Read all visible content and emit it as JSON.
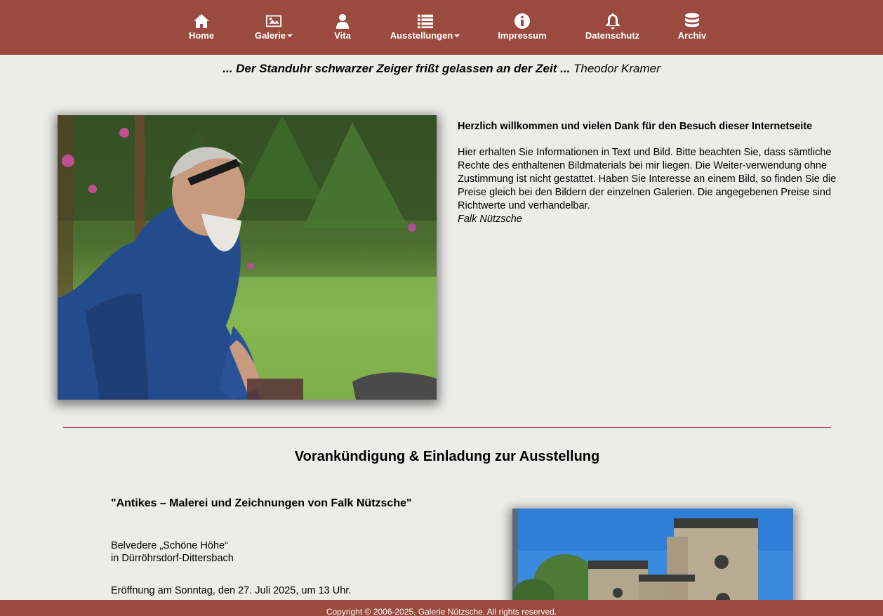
{
  "nav": {
    "items": [
      {
        "label": "Home",
        "icon": "home-icon"
      },
      {
        "label": "Galerie",
        "icon": "picture-icon",
        "dropdown": true
      },
      {
        "label": "Vita",
        "icon": "user-icon"
      },
      {
        "label": "Ausstellungen",
        "icon": "list-icon",
        "dropdown": true
      },
      {
        "label": "Impressum",
        "icon": "info-icon"
      },
      {
        "label": "Datenschutz",
        "icon": "bell-icon"
      },
      {
        "label": "Archiv",
        "icon": "database-icon"
      }
    ]
  },
  "motto": {
    "quote": "... Der Standuhr schwarzer Zeiger frißt gelassen an der Zeit ...",
    "author": "Theodor Kramer"
  },
  "welcome": {
    "heading": "Herzlich willkommen und vielen Dank für den Besuch dieser Internetseite",
    "body": "Hier erhalten Sie Informationen in Text und Bild. Bitte beachten Sie, dass sämtliche Rechte des enthaltenen Bildmaterials bei mir liegen. Die Weiter-verwendung ohne Zustimmung ist nicht gestattet. Haben Sie Interesse an einem Bild, so finden Sie die Preise gleich bei den Bildern der einzelnen Galerien. Die angegebenen Preise sind Richtwerte und verhandelbar.",
    "signature": "Falk Nützsche"
  },
  "announcement": {
    "title": "Vorankündigung & Einladung zur Ausstellung",
    "exhibition_title": "\"Antikes – Malerei und Zeichnungen von Falk Nützsche\"",
    "venue_line1": "Belvedere „Schöne Höhe“",
    "venue_line2": "in Dürröhrsdorf-Dittersbach",
    "opening": "Eröffnung am Sonntag, den 27. Juli 2025, um 13 Uhr."
  },
  "footer": {
    "copyright": "Copyright © 2006-2025, Galerie Nützsche. All rights reserved."
  },
  "colors": {
    "brand": "#9b4a3e",
    "background": "#ececea"
  }
}
